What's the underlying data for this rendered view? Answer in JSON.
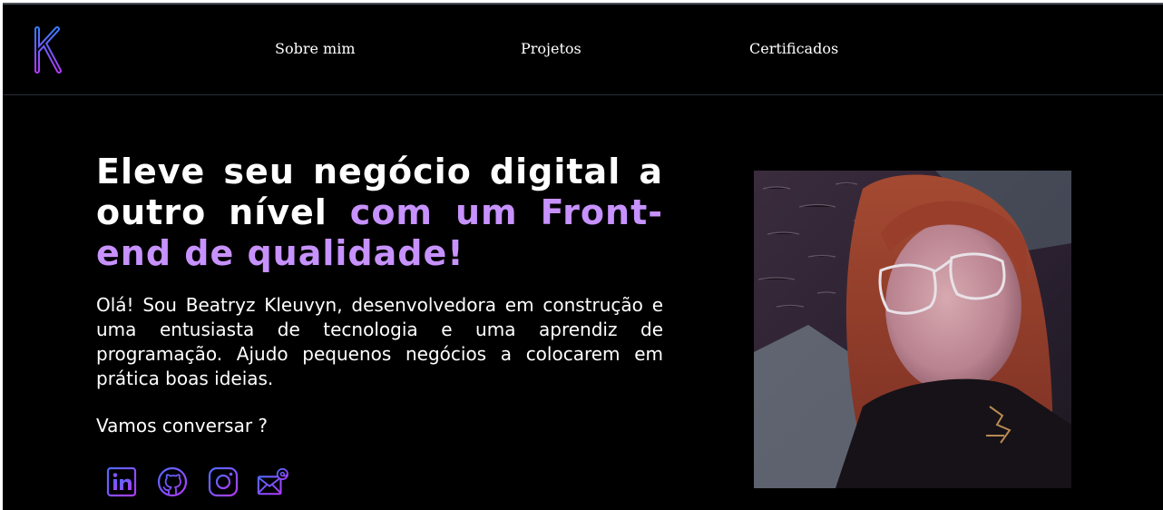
{
  "header": {
    "logo_alt": "K",
    "nav": [
      {
        "label": "Sobre mim"
      },
      {
        "label": "Projetos"
      },
      {
        "label": "Certificados"
      }
    ]
  },
  "hero": {
    "title_part1": "Eleve seu negócio digital a outro nível ",
    "title_accent": "com um Front-end de qualidade!",
    "intro": "Olá! Sou Beatryz Kleuvyn, desenvolvedora em construção e uma entusiasta de tecnologia e uma aprendiz de programação. Ajudo pequenos negócios a colocarem em prática boas ideias.",
    "cta": "Vamos conversar ?"
  },
  "socials": [
    {
      "icon": "linkedin-icon"
    },
    {
      "icon": "github-icon"
    },
    {
      "icon": "instagram-icon"
    },
    {
      "icon": "email-icon"
    }
  ],
  "colors": {
    "background": "#000000",
    "accent": "#c792ff",
    "icon_gradient_start": "#4f6bff",
    "icon_gradient_end": "#b03cff",
    "text": "#ffffff"
  }
}
